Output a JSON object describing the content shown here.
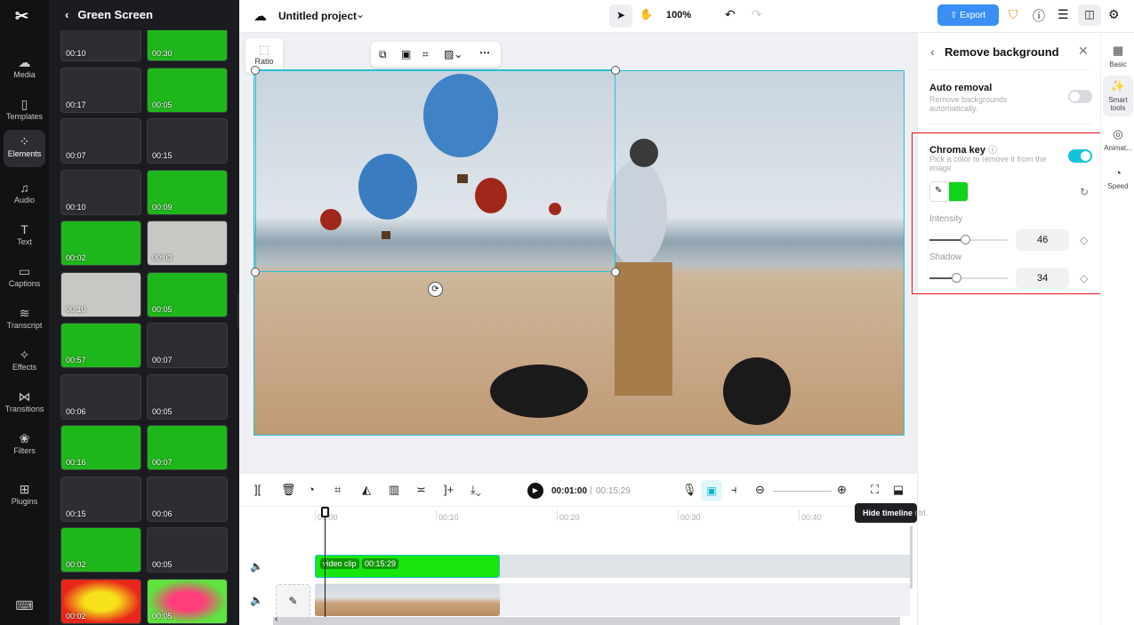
{
  "nav": {
    "items": [
      {
        "label": "Media",
        "icon": "cloud-icon"
      },
      {
        "label": "Templates",
        "icon": "templates-icon"
      },
      {
        "label": "Elements",
        "icon": "elements-icon"
      },
      {
        "label": "Audio",
        "icon": "music-icon"
      },
      {
        "label": "Text",
        "icon": "text-icon"
      },
      {
        "label": "Captions",
        "icon": "captions-icon"
      },
      {
        "label": "Transcript",
        "icon": "transcript-icon"
      },
      {
        "label": "Effects",
        "icon": "effects-icon"
      },
      {
        "label": "Transitions",
        "icon": "transitions-icon"
      },
      {
        "label": "Filters",
        "icon": "filters-icon"
      },
      {
        "label": "Plugins",
        "icon": "plugins-icon"
      }
    ],
    "active": "Elements"
  },
  "panel": {
    "title": "Green Screen",
    "thumbs": [
      "00:10",
      "00:30",
      "00:17",
      "00:05",
      "00:07",
      "00:15",
      "00:10",
      "00:09",
      "00:02",
      "00:03",
      "00:10",
      "00:05",
      "00:57",
      "00:07",
      "00:06",
      "00:05",
      "00:16",
      "00:07",
      "00:15",
      "00:06",
      "00:02",
      "00:05",
      "00:02",
      "00:05"
    ]
  },
  "top": {
    "project": "Untitled project",
    "zoom": "100%",
    "export": "Export"
  },
  "canvas": {
    "ratio": "Ratio"
  },
  "right": {
    "title": "Remove background",
    "auto_title": "Auto removal",
    "auto_desc": "Remove backgrounds automatically.",
    "chroma_title": "Chroma key",
    "chroma_desc": "Pick a color to remove it from the image",
    "color": "#12d31a",
    "intensity_label": "Intensity",
    "intensity": "46",
    "shadow_label": "Shadow",
    "shadow": "34",
    "auto_on": false,
    "chroma_on": true
  },
  "rtabs": [
    "Basic",
    "Smart tools",
    "Animat...",
    "Speed"
  ],
  "timeline": {
    "current": "00:01:00",
    "total": "00:15:29",
    "ticks": [
      "00:00",
      "00:10",
      "00:20",
      "00:30",
      "00:40"
    ],
    "clip_label": "video clip",
    "clip_duration": "00:15:29",
    "tooltip": "Hide timeline",
    "tooltip_key": "ctrl."
  }
}
